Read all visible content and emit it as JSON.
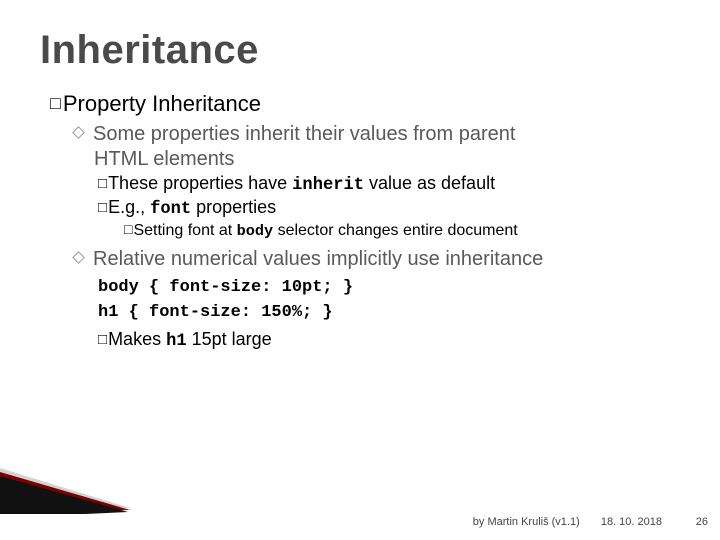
{
  "title": "Inheritance",
  "section": {
    "label_prefix": "Property",
    "label_rest": " Inheritance"
  },
  "bullets": {
    "b1a": "Some properties inherit their values from parent",
    "b1b": "HTML elements",
    "b1_1a": "These properties have ",
    "b1_1code": "inherit",
    "b1_1b": " value as default",
    "b1_2a": "E.g., ",
    "b1_2code": "font",
    "b1_2b": " properties",
    "b1_2_1a": "Setting font at ",
    "b1_2_1code": "body",
    "b1_2_1b": " selector changes entire document",
    "b2": "Relative numerical values implicitly use inheritance",
    "code1": "body { font-size: 10pt; }",
    "code2": "h1 { font-size: 150%; }",
    "b2_1a": "Makes ",
    "b2_1code": "h1",
    "b2_1b": " 15pt large"
  },
  "footer": {
    "author": "by Martin Kruliš (v1.1)",
    "date": "18. 10. 2018",
    "page": "26"
  }
}
